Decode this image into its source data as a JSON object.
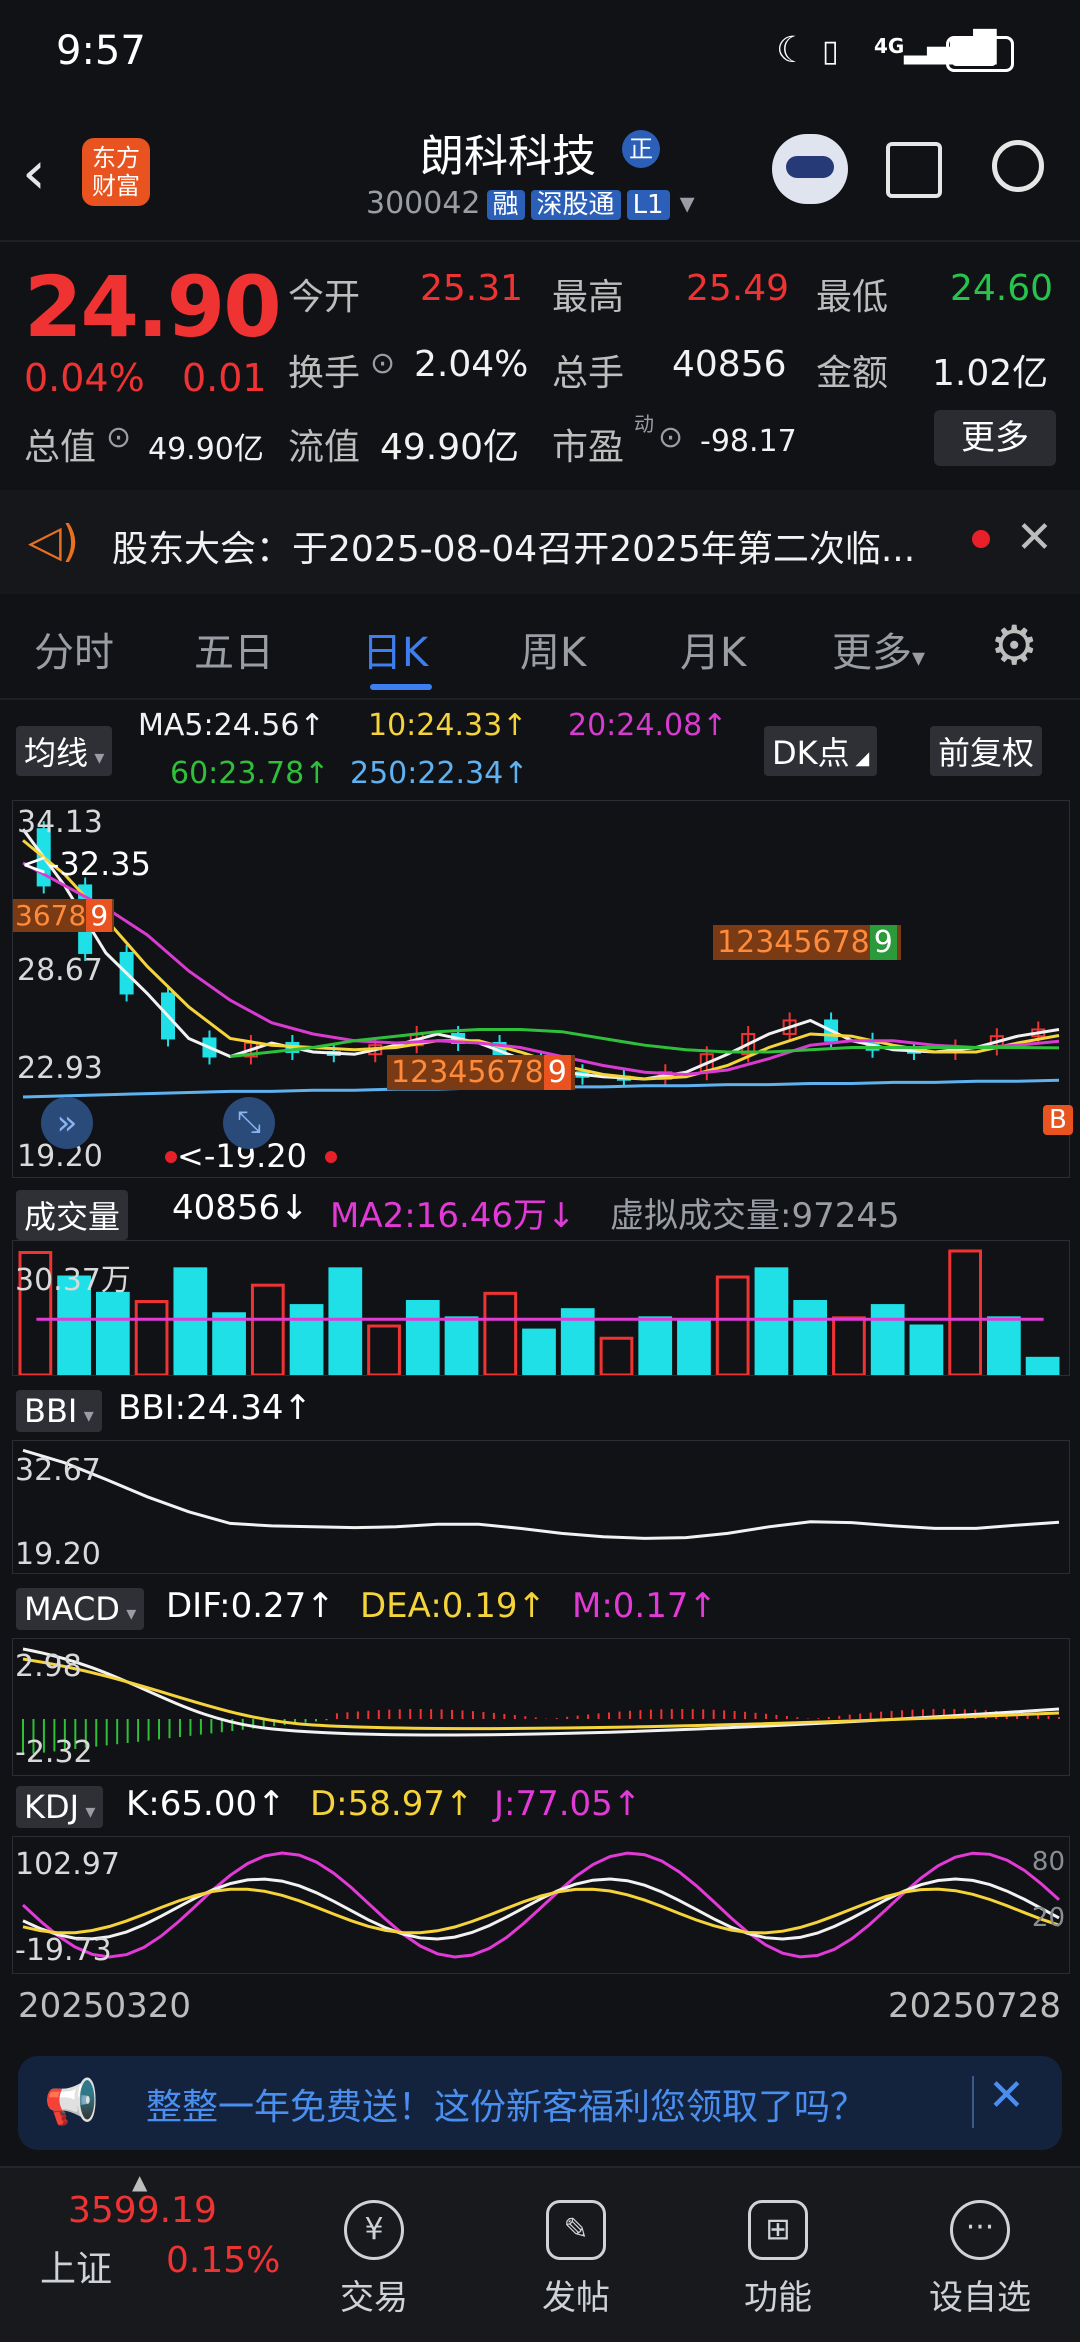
{
  "status_bar": {
    "time": "9:57",
    "network": "4G"
  },
  "header": {
    "back_icon": "chevron-left-icon",
    "brand_logo_text": [
      "东方",
      "财富"
    ],
    "stock_name": "朗科科技",
    "stock_name_badge": "正",
    "stock_code": "300042",
    "tags": [
      "融",
      "深股通",
      "L1"
    ],
    "icons": [
      "robot-assistant-icon",
      "share-icon",
      "search-icon"
    ]
  },
  "quote": {
    "price": "24.90",
    "change_pct": "0.04%",
    "change": "0.01",
    "fields": [
      {
        "label": "今开",
        "value": "25.31",
        "color": "#ef3333"
      },
      {
        "label": "最高",
        "value": "25.49",
        "color": "#ef3333"
      },
      {
        "label": "最低",
        "value": "24.60",
        "color": "#27c44b"
      },
      {
        "label": "换手",
        "value": "2.04%",
        "color": "#f2f2f2"
      },
      {
        "label": "总手",
        "value": "40856",
        "color": "#f2f2f2"
      },
      {
        "label": "金额",
        "value": "1.02亿",
        "color": "#f2f2f2"
      }
    ],
    "total_value_label": "总值",
    "total_value": "49.90亿",
    "float_value_label": "流值",
    "float_value": "49.90亿",
    "pe_label": "市盈",
    "pe_superscript": "动",
    "pe_value": "-98.17",
    "more_button": "更多"
  },
  "notice": {
    "icon": "speaker-icon",
    "text": "股东大会：于2025-08-04召开2025年第二次临...",
    "close_icon": "close-icon"
  },
  "tabs": {
    "items": [
      "分时",
      "五日",
      "日K",
      "周K",
      "月K",
      "更多"
    ],
    "active_index": 2,
    "settings_icon": "gear-icon"
  },
  "kline": {
    "indicator_button": "均线",
    "ma": [
      {
        "label": "MA5:24.56↑",
        "color": "#f2f2f2"
      },
      {
        "label": "10:24.33↑",
        "color": "#f5d33a"
      },
      {
        "label": "20:24.08↑",
        "color": "#d93bd1"
      },
      {
        "label": "60:23.78↑",
        "color": "#2fbf3a"
      },
      {
        "label": "250:22.34↑",
        "color": "#5fb2f0"
      }
    ],
    "dk_button": "DK点",
    "adjust_button": "前复权",
    "y_labels": [
      "34.13",
      "28.67",
      "22.93",
      "19.20"
    ],
    "high_marker": "<-32.35",
    "low_marker": "<-19.20",
    "seq_numbers_left": [
      "3",
      "6",
      "7",
      "8",
      "9"
    ],
    "seq_numbers_mid": [
      "1",
      "2",
      "3",
      "4",
      "5",
      "6",
      "7",
      "8",
      "9"
    ],
    "seq_numbers_right": [
      "1",
      "2",
      "3",
      "4",
      "5",
      "6",
      "7",
      "8",
      "9"
    ],
    "right_badge": "B"
  },
  "volume": {
    "button": "成交量",
    "value": "40856↓",
    "ma2": "MA2:16.46万↓",
    "virtual": "虚拟成交量:97245",
    "y_label": "30.37万"
  },
  "bbi": {
    "button": "BBI",
    "value": "BBI:24.34↑",
    "y_labels": [
      "32.67",
      "19.20"
    ]
  },
  "macd": {
    "button": "MACD",
    "dif": "DIF:0.27↑",
    "dea": "DEA:0.19↑",
    "m": "M:0.17↑",
    "y_labels": [
      "2.98",
      "-2.32"
    ]
  },
  "kdj": {
    "button": "KDJ",
    "k": "K:65.00↑",
    "d": "D:58.97↑",
    "j": "J:77.05↑",
    "y_labels": [
      "102.97",
      "-19.73"
    ],
    "right_labels": [
      "80",
      "20"
    ]
  },
  "dates": {
    "start": "20250320",
    "end": "20250728"
  },
  "ad": {
    "icon": "megaphone-icon",
    "text": "整整一年免费送！这份新客福利您领取了吗？",
    "close_icon": "close-icon"
  },
  "bottom_nav": {
    "index_value": "3599.19",
    "index_name": "上证",
    "index_change": "0.15%",
    "items": [
      {
        "label": "交易",
        "icon": "yen-trade-icon"
      },
      {
        "label": "发帖",
        "icon": "edit-post-icon"
      },
      {
        "label": "功能",
        "icon": "grid-function-icon"
      },
      {
        "label": "设自选",
        "icon": "more-dots-icon"
      }
    ]
  },
  "chart_data": [
    {
      "type": "line",
      "title": "",
      "x_range": [
        "20250320",
        "20250728"
      ],
      "ylim": [
        19.2,
        34.13
      ],
      "series": [
        {
          "name": "MA5",
          "values": [
            33.5,
            31.0,
            28.0,
            26.2,
            24.2,
            23.4,
            24.0,
            23.6,
            23.5,
            23.9,
            24.4,
            24.0,
            23.3,
            22.7,
            22.5,
            22.4,
            22.7,
            23.5,
            24.4,
            25.0,
            24.1,
            23.7,
            23.6,
            23.8,
            24.3,
            24.6
          ]
        },
        {
          "name": "10",
          "values": [
            33.0,
            31.5,
            29.5,
            27.4,
            25.6,
            24.2,
            23.9,
            23.8,
            23.7,
            23.8,
            24.1,
            24.1,
            23.6,
            23.0,
            22.6,
            22.4,
            22.5,
            23.0,
            23.8,
            24.4,
            24.3,
            23.9,
            23.6,
            23.6,
            24.0,
            24.33
          ]
        },
        {
          "name": "20",
          "values": [
            32.0,
            31.0,
            30.0,
            28.8,
            27.2,
            25.9,
            24.9,
            24.4,
            24.1,
            24.0,
            24.1,
            24.0,
            23.8,
            23.4,
            23.0,
            22.7,
            22.6,
            22.8,
            23.3,
            23.9,
            24.1,
            24.1,
            23.9,
            23.8,
            23.9,
            24.08
          ]
        },
        {
          "name": "60",
          "values": [
            null,
            null,
            null,
            null,
            null,
            23.4,
            23.6,
            23.8,
            24.1,
            24.3,
            24.5,
            24.6,
            24.6,
            24.5,
            24.2,
            23.9,
            23.7,
            23.6,
            23.6,
            23.7,
            23.8,
            23.8,
            23.8,
            23.8,
            23.8,
            23.78
          ]
        },
        {
          "name": "250",
          "values": [
            21.6,
            21.65,
            21.7,
            21.75,
            21.8,
            21.85,
            21.85,
            21.9,
            21.9,
            21.95,
            21.95,
            22.0,
            22.0,
            22.05,
            22.05,
            22.1,
            22.1,
            22.15,
            22.15,
            22.2,
            22.2,
            22.25,
            22.25,
            22.3,
            22.3,
            22.34
          ]
        }
      ]
    },
    {
      "type": "bar",
      "title": "",
      "ylim": [
        0,
        303700
      ],
      "values": [
        300000,
        240000,
        200000,
        180000,
        260000,
        150000,
        220000,
        170000,
        260000,
        120000,
        180000,
        140000,
        200000,
        110000,
        160000,
        90000,
        140000,
        130000,
        240000,
        260000,
        180000,
        140000,
        170000,
        120000,
        303700,
        140000,
        40856
      ]
    }
  ]
}
